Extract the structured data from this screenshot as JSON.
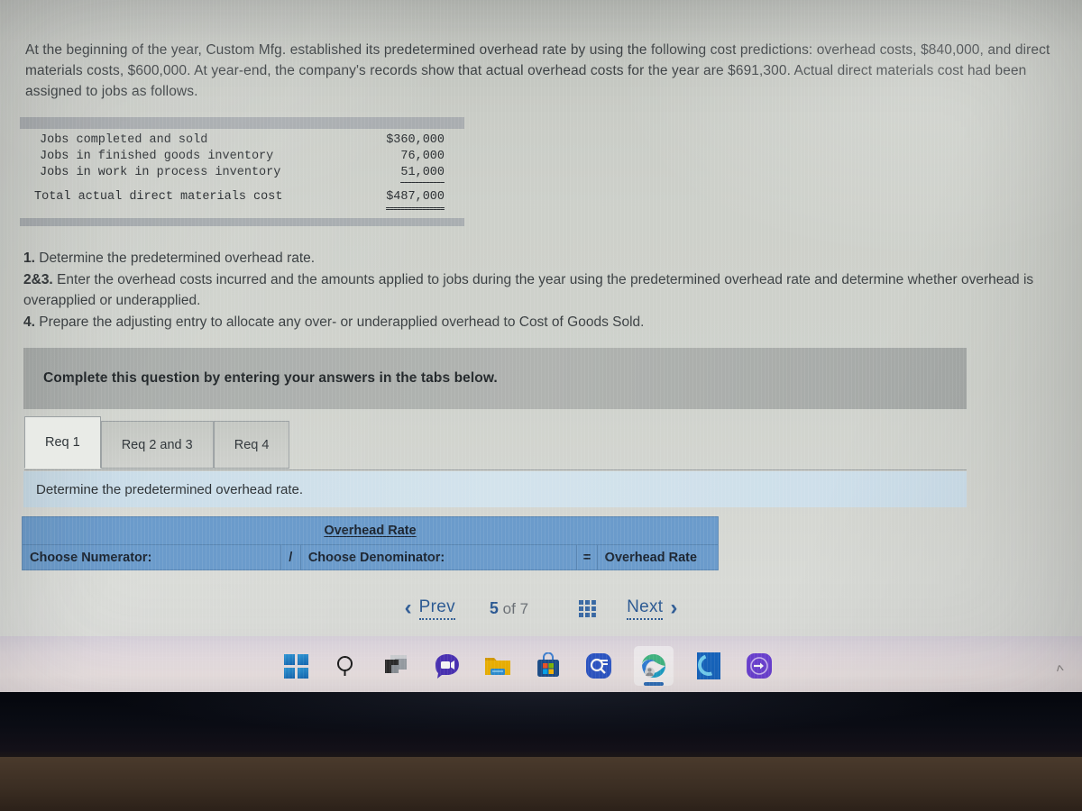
{
  "prompt": {
    "text": "At the beginning of the year, Custom Mfg. established its predetermined overhead rate by using the following cost predictions: overhead costs, $840,000, and direct materials costs, $600,000. At year-end, the company's records show that actual overhead costs for the year are $691,300. Actual direct materials cost had been assigned to jobs as follows."
  },
  "cost_table": {
    "rows": [
      {
        "label": "Jobs completed and sold",
        "value": "$360,000"
      },
      {
        "label": "Jobs in finished goods inventory",
        "value": "76,000"
      },
      {
        "label": "Jobs in work in process inventory",
        "value": "51,000"
      }
    ],
    "total_label": "Total actual direct materials cost",
    "total_value": "$487,000"
  },
  "requirements": {
    "r1_num": "1.",
    "r1_text": " Determine the predetermined overhead rate.",
    "r23_num": "2&3.",
    "r23_text": " Enter the overhead costs incurred and the amounts applied to jobs during the year using the predetermined overhead rate and determine whether overhead is overapplied or underapplied.",
    "r4_num": "4.",
    "r4_text": " Prepare the adjusting entry to allocate any over- or underapplied overhead to Cost of Goods Sold."
  },
  "banner": {
    "text": "Complete this question by entering your answers in the tabs below."
  },
  "tabs": [
    {
      "label": "Req 1",
      "active": true
    },
    {
      "label": "Req 2 and 3",
      "active": false
    },
    {
      "label": "Req 4",
      "active": false
    }
  ],
  "sub_instruction": {
    "text": "Determine the predetermined overhead rate."
  },
  "answer_table": {
    "header": "Overhead Rate",
    "numerator_label": "Choose Numerator:",
    "divide_symbol": "/",
    "denominator_label": "Choose Denominator:",
    "equals_symbol": "=",
    "result_label": "Overhead Rate"
  },
  "pager": {
    "prev_label": "Prev",
    "current_page": "5",
    "of_label": "of",
    "total_pages": "7",
    "next_label": "Next",
    "prev_chevron": "‹",
    "next_chevron": "›"
  },
  "taskbar": {
    "items": [
      {
        "name": "start",
        "label": "Start"
      },
      {
        "name": "search",
        "label": "Search"
      },
      {
        "name": "task-view",
        "label": "Task View"
      },
      {
        "name": "chat",
        "label": "Chat"
      },
      {
        "name": "file-explorer",
        "label": "File Explorer"
      },
      {
        "name": "microsoft-store",
        "label": "Microsoft Store"
      },
      {
        "name": "search-app",
        "label": "Search App"
      },
      {
        "name": "microsoft-edge",
        "label": "Microsoft Edge",
        "active": true
      },
      {
        "name": "alexa",
        "label": "Alexa"
      },
      {
        "name": "sign-out",
        "label": "Sign Out"
      }
    ]
  },
  "colors": {
    "table_header_blue": "#6b9bcb",
    "banner_gray": "#a9adab",
    "sub_strip_blue": "#cfe0ea",
    "link_blue": "#2c5a94",
    "page_bg": "#cfd2cc"
  }
}
